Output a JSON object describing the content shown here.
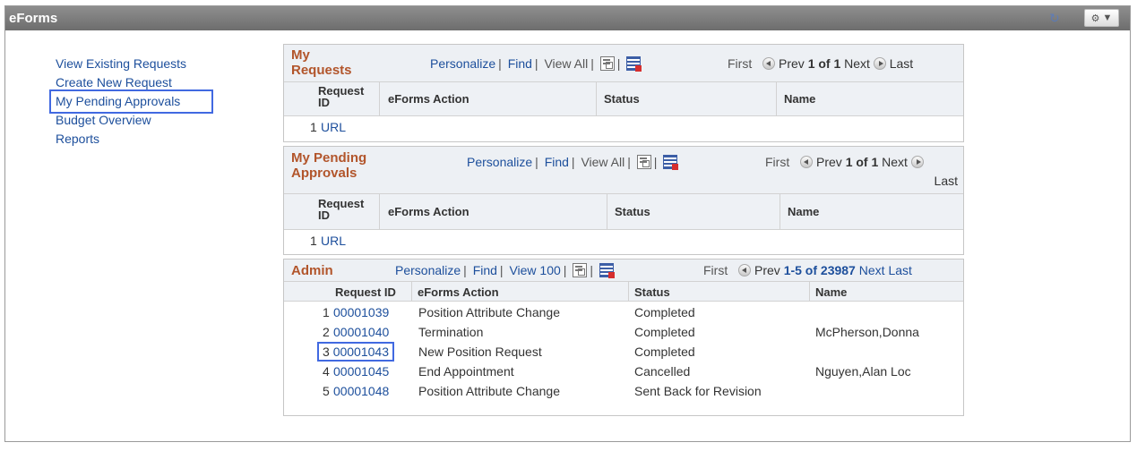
{
  "window": {
    "title": "eForms"
  },
  "nav": {
    "items": [
      {
        "label": "View Existing Requests"
      },
      {
        "label": "Create New Request"
      },
      {
        "label": "My Pending Approvals"
      },
      {
        "label": "Budget Overview"
      },
      {
        "label": "Reports"
      }
    ]
  },
  "grid_controls": {
    "personalize": "Personalize",
    "find": "Find",
    "view_all": "View All",
    "view_100": "View 100",
    "first": "First",
    "prev": "Prev",
    "next": "Next",
    "last": "Last",
    "sep": "|"
  },
  "my_requests": {
    "title_line1": "My",
    "title_line2": "Requests",
    "page": "1 of 1",
    "columns": {
      "request_id_1": "Request",
      "request_id_2": "ID",
      "action": "eForms Action",
      "status": "Status",
      "name": "Name"
    },
    "rows": [
      {
        "num": "1",
        "id": "URL"
      }
    ]
  },
  "my_pending": {
    "title_line1": "My Pending",
    "title_line2": "Approvals",
    "page": "1 of 1",
    "columns": {
      "request_id_1": "Request",
      "request_id_2": "ID",
      "action": "eForms Action",
      "status": "Status",
      "name": "Name"
    },
    "rows": [
      {
        "num": "1",
        "id": "URL"
      }
    ]
  },
  "admin": {
    "title": "Admin",
    "page": "1-5 of 23987",
    "columns": {
      "request_id": "Request ID",
      "action": "eForms Action",
      "status": "Status",
      "name": "Name"
    },
    "rows": [
      {
        "num": "1",
        "id": "00001039",
        "action": "Position Attribute Change",
        "status": "Completed",
        "name": ""
      },
      {
        "num": "2",
        "id": "00001040",
        "action": "Termination",
        "status": "Completed",
        "name": "McPherson,Donna"
      },
      {
        "num": "3",
        "id": "00001043",
        "action": "New Position Request",
        "status": "Completed",
        "name": ""
      },
      {
        "num": "4",
        "id": "00001045",
        "action": "End Appointment",
        "status": "Cancelled",
        "name": "Nguyen,Alan Loc"
      },
      {
        "num": "5",
        "id": "00001048",
        "action": "Position Attribute Change",
        "status": "Sent Back for Revision",
        "name": ""
      }
    ]
  },
  "colors": {
    "title_orange": "#b2552b",
    "link_blue": "#1d4f9c",
    "highlight": "#4169e1"
  }
}
